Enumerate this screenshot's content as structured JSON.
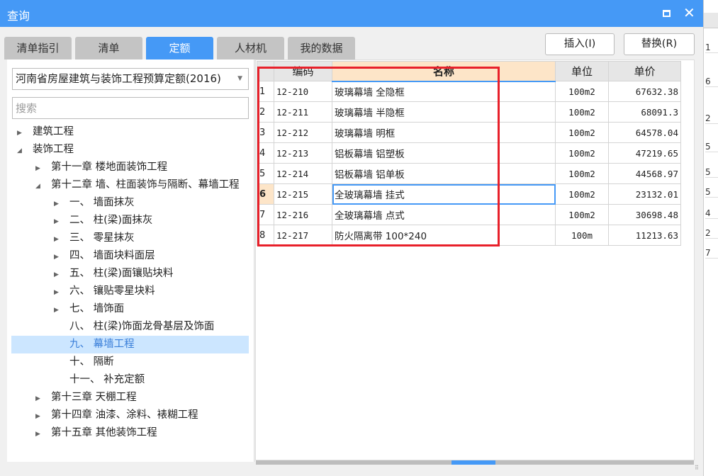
{
  "window": {
    "title": "查询"
  },
  "tabs": [
    {
      "label": "清单指引"
    },
    {
      "label": "清单"
    },
    {
      "label": "定额",
      "active": true
    },
    {
      "label": "人材机"
    },
    {
      "label": "我的数据"
    }
  ],
  "left": {
    "dropdown_value": "河南省房屋建筑与装饰工程预算定额(2016)",
    "search_placeholder": "搜索",
    "tree": [
      {
        "label": "建筑工程",
        "level": 0,
        "toggle": "collapsed"
      },
      {
        "label": "装饰工程",
        "level": 0,
        "toggle": "expanded"
      },
      {
        "label": "第十一章 楼地面装饰工程",
        "level": 1,
        "toggle": "collapsed"
      },
      {
        "label": "第十二章 墙、柱面装饰与隔断、幕墙工程",
        "level": 1,
        "toggle": "expanded"
      },
      {
        "label": "一、  墙面抹灰",
        "level": 2,
        "toggle": "collapsed"
      },
      {
        "label": "二、  柱(梁)面抹灰",
        "level": 2,
        "toggle": "collapsed"
      },
      {
        "label": "三、  零星抹灰",
        "level": 2,
        "toggle": "collapsed"
      },
      {
        "label": "四、  墙面块料面层",
        "level": 2,
        "toggle": "collapsed"
      },
      {
        "label": "五、  柱(梁)面镶贴块料",
        "level": 2,
        "toggle": "collapsed"
      },
      {
        "label": "六、  镶贴零星块料",
        "level": 2,
        "toggle": "collapsed"
      },
      {
        "label": "七、  墙饰面",
        "level": 2,
        "toggle": "collapsed"
      },
      {
        "label": "八、  柱(梁)饰面龙骨基层及饰面",
        "level": 2,
        "toggle": "none"
      },
      {
        "label": "九、  幕墙工程",
        "level": 2,
        "toggle": "none",
        "selected": true
      },
      {
        "label": "十、  隔断",
        "level": 2,
        "toggle": "none"
      },
      {
        "label": "十一、  补充定额",
        "level": 2,
        "toggle": "none"
      },
      {
        "label": "第十三章 天棚工程",
        "level": 1,
        "toggle": "collapsed"
      },
      {
        "label": "第十四章 油漆、涂料、裱糊工程",
        "level": 1,
        "toggle": "collapsed"
      },
      {
        "label": "第十五章 其他装饰工程",
        "level": 1,
        "toggle": "collapsed"
      }
    ]
  },
  "buttons": {
    "insert": "插入(I)",
    "replace": "替换(R)"
  },
  "grid": {
    "columns": [
      "",
      "编码",
      "名称",
      "单位",
      "单价"
    ],
    "current_row": 6,
    "rows": [
      [
        "1",
        "12-210",
        "玻璃幕墙 全隐框",
        "100m2",
        "67632.38"
      ],
      [
        "2",
        "12-211",
        "玻璃幕墙 半隐框",
        "100m2",
        "68091.3"
      ],
      [
        "3",
        "12-212",
        "玻璃幕墙 明框",
        "100m2",
        "64578.04"
      ],
      [
        "4",
        "12-213",
        "铝板幕墙 铝塑板",
        "100m2",
        "47219.65"
      ],
      [
        "5",
        "12-214",
        "铝板幕墙 铝单板",
        "100m2",
        "44568.97"
      ],
      [
        "6",
        "12-215",
        "全玻璃幕墙 挂式",
        "100m2",
        "23132.01"
      ],
      [
        "7",
        "12-216",
        "全玻璃幕墙 点式",
        "100m2",
        "30698.48"
      ],
      [
        "8",
        "12-217",
        "防火隔离带 100*240",
        "100m",
        "11213.63"
      ]
    ]
  },
  "background_column": [
    "1",
    "6",
    "2",
    "5",
    "5",
    "5",
    "4",
    "2",
    "7"
  ],
  "colors": {
    "accent": "#4599f6",
    "highlight_box": "#e8202a",
    "header_highlight": "#fde5c8"
  }
}
